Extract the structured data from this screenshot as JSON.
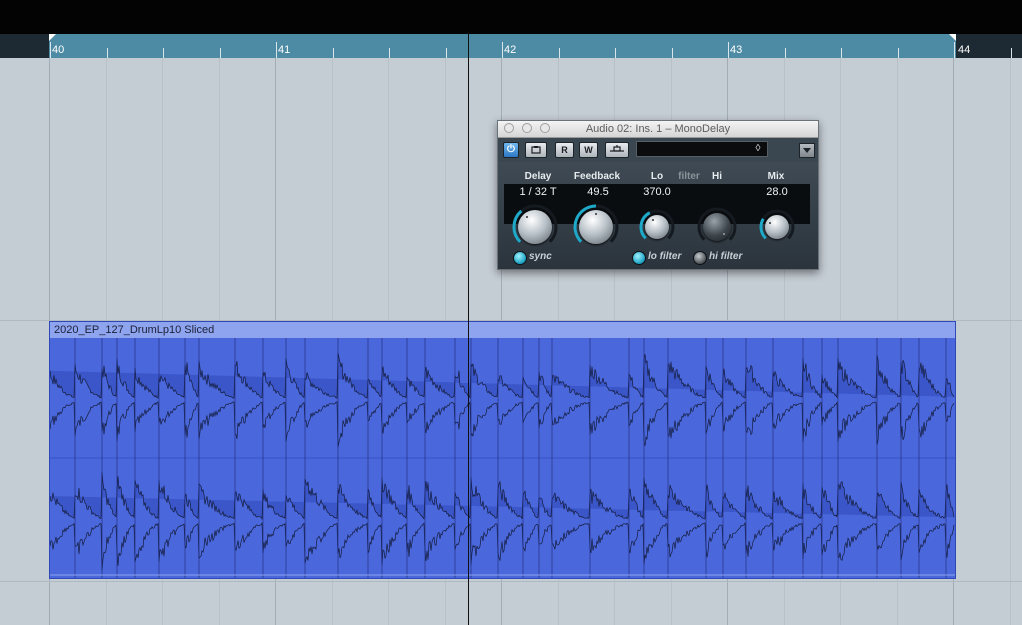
{
  "ruler": {
    "bars": [
      "40",
      "41",
      "42",
      "43",
      "44"
    ]
  },
  "event": {
    "name": "2020_EP_127_DrumLp10 Sliced"
  },
  "plugin": {
    "title": "Audio 02: Ins. 1 – MonoDelay",
    "toolbar": {
      "read_label": "R",
      "write_label": "W"
    },
    "labels": {
      "delay": "Delay",
      "feedback": "Feedback",
      "lo": "Lo",
      "filter": "filter",
      "hi": "Hi",
      "mix": "Mix"
    },
    "values": {
      "delay": "1 / 32 T",
      "feedback": "49.5",
      "lo": "370.0",
      "mix": "28.0"
    },
    "toggles": {
      "sync": "sync",
      "lo_filter": "lo filter",
      "hi_filter": "hi filter"
    },
    "knob_levels": {
      "delay": 0.35,
      "feedback": 0.5,
      "lo": 0.4,
      "hi": 1.0,
      "mix": 0.28
    }
  },
  "colors": {
    "accent": "#1fa9c9",
    "event_fill": "#4563d8",
    "loop": "#4d8aa3"
  },
  "icons": {
    "power": "power-icon",
    "bypass": "bypass-icon",
    "preset_menu": "preset-menu-icon"
  }
}
